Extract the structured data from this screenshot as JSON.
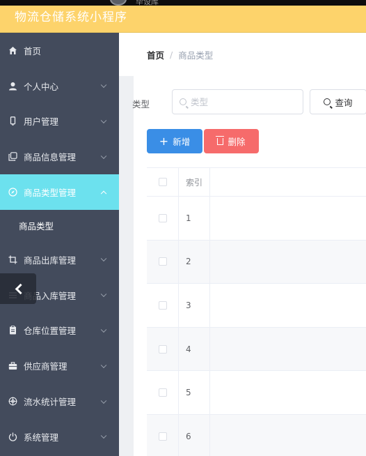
{
  "app": {
    "title": "物流仓储系统小程序",
    "top_caption": "毕设库"
  },
  "sidebar": {
    "items": [
      {
        "label": "首页",
        "icon": "home-icon",
        "expandable": false
      },
      {
        "label": "个人中心",
        "icon": "user-icon",
        "expandable": true
      },
      {
        "label": "用户管理",
        "icon": "phone-icon",
        "expandable": true
      },
      {
        "label": "商品信息管理",
        "icon": "copy-icon",
        "expandable": true
      },
      {
        "label": "商品类型管理",
        "icon": "compass-icon",
        "expandable": true,
        "active": true
      },
      {
        "label": "商品出库管理",
        "icon": "crop-icon",
        "expandable": true
      },
      {
        "label": "商品入库管理",
        "icon": "list-icon",
        "expandable": true
      },
      {
        "label": "仓库位置管理",
        "icon": "document-icon",
        "expandable": true
      },
      {
        "label": "供应商管理",
        "icon": "suitcase-icon",
        "expandable": true
      },
      {
        "label": "流水统计管理",
        "icon": "target-icon",
        "expandable": true
      },
      {
        "label": "系统管理",
        "icon": "power-icon",
        "expandable": true
      }
    ],
    "sub_item": "商品类型"
  },
  "breadcrumb": {
    "home": "首页",
    "separator": "/",
    "current": "商品类型"
  },
  "search": {
    "label": "类型",
    "placeholder": "类型",
    "value": "",
    "button_label": "查询"
  },
  "actions": {
    "add_label": "新增",
    "delete_label": "删除"
  },
  "table": {
    "header": "索引",
    "rows": [
      "1",
      "2",
      "3",
      "4",
      "5",
      "6"
    ]
  },
  "colors": {
    "header_bg": "#fdd36b",
    "sidebar_bg": "#434b5c",
    "active_bg": "#6ce1ee",
    "primary": "#3a8ee6",
    "danger": "#f66b6b"
  }
}
